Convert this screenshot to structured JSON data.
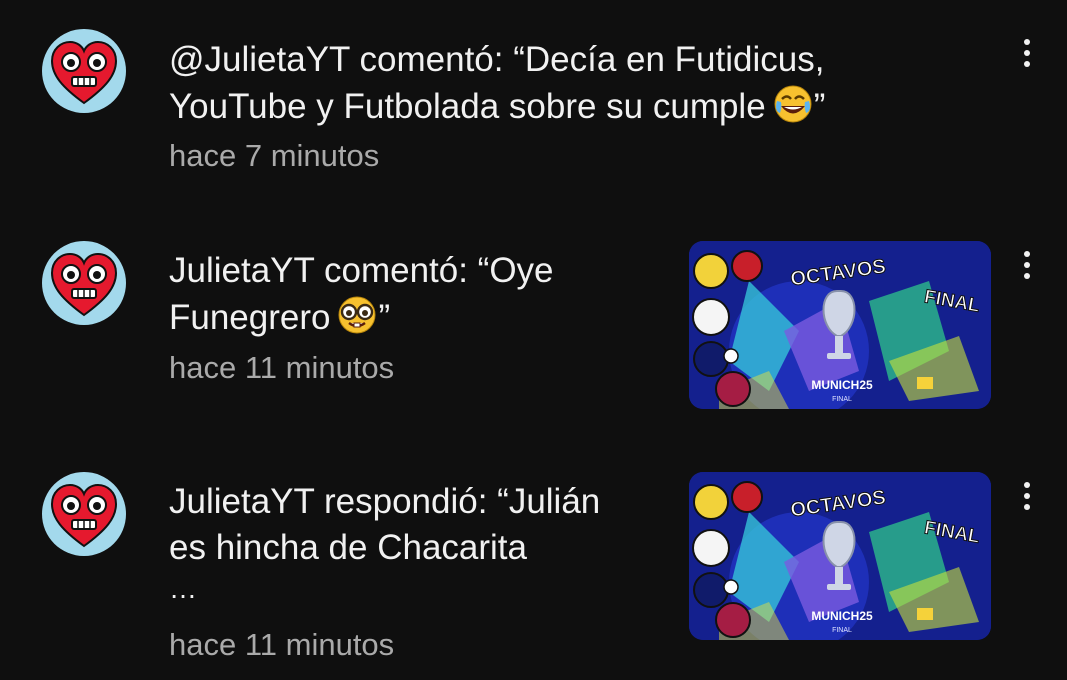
{
  "notifications": [
    {
      "message_line1": "@JulietaYT comentó: “Decía en Futidicus,",
      "message_line2": "YouTube y Futbolada sobre su cumple",
      "message_end": "”",
      "emoji": "tears-of-joy-emoji",
      "time": "hace 7 minutos",
      "has_thumbnail": false
    },
    {
      "message_line1": "JulietaYT comentó: “Oye",
      "message_line2": "Funegrero",
      "message_end": "”",
      "emoji": "nerd-face-emoji",
      "time": "hace 11 minutos",
      "has_thumbnail": true,
      "thumbnail": {
        "title_word1": "OCTAVOS",
        "title_word2": "FINAL",
        "event": "MUNICH25",
        "event_sub": "FINAL"
      }
    },
    {
      "message_line1": "JulietaYT respondió: “Julián",
      "message_line2": "es hincha de Chacarita",
      "message_line3": "…",
      "time": "hace 11 minutos",
      "has_thumbnail": true,
      "thumbnail": {
        "title_word1": "OCTAVOS",
        "title_word2": "FINAL",
        "event": "MUNICH25",
        "event_sub": "FINAL"
      }
    }
  ],
  "icons": {
    "avatar": "heart-face-avatar",
    "menu": "more-vert-icon"
  },
  "colors": {
    "background": "#0f0f0f",
    "primary_text": "#f1f1f1",
    "secondary_text": "#aaaaaa",
    "avatar_bg": "#a3d9ec",
    "heart": "#e5192e",
    "thumbnail_bg": "#14208e"
  }
}
